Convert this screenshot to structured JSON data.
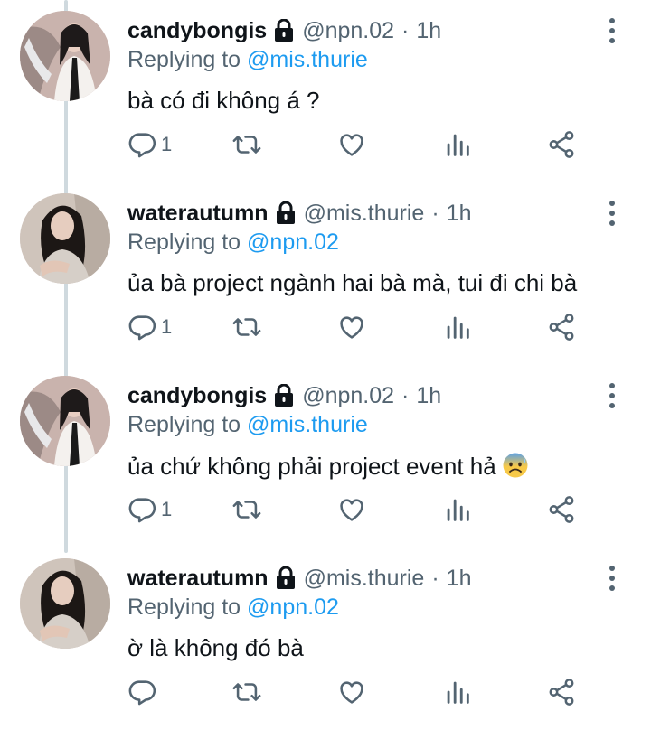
{
  "colors": {
    "text": "#0f1419",
    "muted": "#536471",
    "link": "#1d9bf0",
    "thread": "#cfd9de"
  },
  "icons": {
    "reply": "reply-icon",
    "retweet": "retweet-icon",
    "like": "heart-icon",
    "views": "views-icon",
    "share": "share-icon",
    "more": "more-vertical-icon",
    "lock": "lock-icon"
  },
  "tweets": [
    {
      "name": "candybongis",
      "handle": "@npn.02",
      "dot": "·",
      "time": "1h",
      "replying_prefix": "Replying to",
      "replying_to": "@mis.thurie",
      "text": "bà có đi không á ?",
      "reply_count": "1"
    },
    {
      "name": "waterautumn",
      "handle": "@mis.thurie",
      "dot": "·",
      "time": "1h",
      "replying_prefix": "Replying to",
      "replying_to": "@npn.02",
      "text": "ủa bà project ngành hai bà mà, tui đi chi bà",
      "reply_count": "1"
    },
    {
      "name": "candybongis",
      "handle": "@npn.02",
      "dot": "·",
      "time": "1h",
      "replying_prefix": "Replying to",
      "replying_to": "@mis.thurie",
      "text": "ủa chứ không phải project event hả",
      "emoji": "anxious-face-with-sweat",
      "reply_count": "1"
    },
    {
      "name": "waterautumn",
      "handle": "@mis.thurie",
      "dot": "·",
      "time": "1h",
      "replying_prefix": "Replying to",
      "replying_to": "@npn.02",
      "text": "ờ là không đó bà",
      "reply_count": ""
    }
  ]
}
